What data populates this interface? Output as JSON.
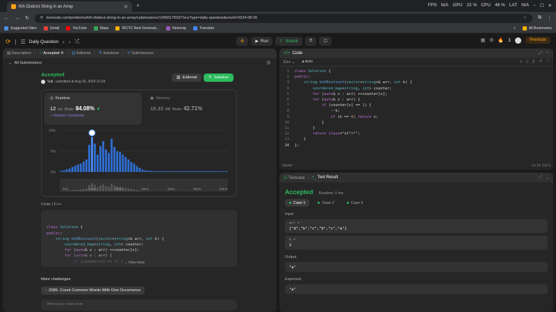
{
  "browser": {
    "tab_title": "Kth Distinct String in an Array",
    "url": "leetcode.com/problems/kth-distinct-string-in-an-array/submissions/1345617593/?envType=daily-question&envId=2024-08-05",
    "sys": {
      "fps": "FPS",
      "fps_val": "N/A",
      "gpu": "GPU",
      "gpu_val": "22 %",
      "cpu": "CPU",
      "cpu_val": "46 %",
      "lat": "LAT",
      "lat_val": "N/A"
    },
    "bookmarks": [
      "Suggested Sites",
      "Gmail",
      "YouTube",
      "Maps",
      "IRCTC Next Generati...",
      "Newsnip",
      "Translate"
    ],
    "all_bookmarks": "All Bookmarks"
  },
  "nav": {
    "daily_question": "Daily Question",
    "run": "Run",
    "submit": "Submit",
    "streak": "1",
    "premium": "Premium"
  },
  "left": {
    "tabs": {
      "description": "Description",
      "accepted": "Accepted",
      "editorial": "Editorial",
      "solutions": "Solutions",
      "submissions": "Submissions"
    },
    "all_submissions": "All Submissions",
    "status": "Accepted",
    "user": "Vult",
    "submitted": "submitted at Aug 05, 2024 22:24",
    "editorial_btn": "Editorial",
    "solution_btn": "Solution",
    "runtime_label": "Runtime",
    "runtime_val": "12",
    "runtime_unit": "ms",
    "beats": "Beats",
    "runtime_pct": "84.08%",
    "analyze": "Analyze Complexity",
    "memory_label": "Memory",
    "memory_val": "18.33",
    "memory_unit": "MB",
    "memory_pct": "42.71%",
    "code_lang": "Code  |  C++",
    "view_more": "View more",
    "more_challenges": "More challenges",
    "challenge": "2085. Count Common Words With One Occurrence",
    "notes_placeholder": "Write your notes here"
  },
  "code_lines": [
    "class Solution {",
    "public:",
    "    string kthDistinct(vector<string>& arr, int k) {",
    "        unordered_map<string, int> counter;",
    "        for (auto& v : arr) ++counter[v];",
    "        for (auto& v : arr) {",
    "            if (counter[v] == 1) {",
    "                --k;",
    "                if (k == 0) return v;",
    "            }",
    "        }",
    "        return \"\";",
    "    }",
    "};"
  ],
  "editor": {
    "title": "Code",
    "lang": "C++",
    "auto": "Auto",
    "saved": "Saved",
    "position": "Ln 14, Col 3"
  },
  "test": {
    "testcase_tab": "Testcase",
    "result_tab": "Test Result",
    "status": "Accepted",
    "runtime": "Runtime: 0 ms",
    "cases": [
      "Case 1",
      "Case 2",
      "Case 3"
    ],
    "input_label": "Input",
    "arr_key": "arr =",
    "arr_val": "[\"d\",\"b\",\"c\",\"b\",\"c\",\"a\"]",
    "k_key": "k =",
    "k_val": "2",
    "output_label": "Output",
    "output_val": "\"a\"",
    "expected_label": "Expected",
    "expected_val": "\"a\""
  },
  "chart_data": {
    "type": "bar",
    "ylabel_ticks": [
      "10%",
      "5%",
      "0%"
    ],
    "ylim": [
      0,
      10
    ],
    "x_ticks": [
      "3ms",
      "13ms",
      "23ms",
      "33ms",
      "43ms",
      "53ms",
      "64ms"
    ],
    "highlight_index": 11,
    "values": [
      0.3,
      0.4,
      0.6,
      0.8,
      1.2,
      1.5,
      1.8,
      2.0,
      2.5,
      3.0,
      6.5,
      8.4,
      6.8,
      4.2,
      6.2,
      7.4,
      5.4,
      4.6,
      8.0,
      6.0,
      5.0,
      4.8,
      4.2,
      3.6,
      3.0,
      2.4,
      2.0,
      1.4,
      1.0,
      0.6,
      0.4,
      0.3,
      0.3,
      0.2,
      0.2,
      0.2,
      0.2,
      0.2,
      0.2,
      0.2,
      0.2,
      0.2,
      0.2,
      0.2,
      0.2,
      0.2,
      0.2,
      0.2,
      0.2,
      0.2,
      0.2,
      0.2,
      0.2,
      0.2,
      0.2,
      0.2,
      0.2,
      0.2,
      0.2,
      0.2
    ]
  }
}
